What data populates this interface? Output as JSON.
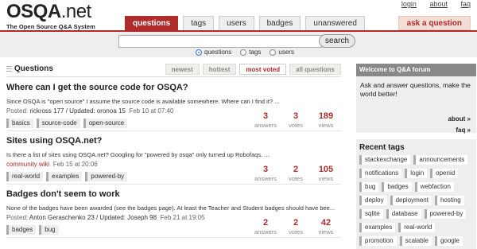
{
  "toplinks": [
    "login",
    "about",
    "faq"
  ],
  "logo": {
    "main": "OSQA",
    "net": ".net",
    "sub": "The Open Source Q&A System"
  },
  "nav": {
    "tabs": [
      "questions",
      "tags",
      "users",
      "badges",
      "unanswered"
    ],
    "active": "questions",
    "ask": "ask a question"
  },
  "search": {
    "value": "",
    "placeholder": "",
    "button": "search",
    "scopes": [
      "questions",
      "tags",
      "users"
    ],
    "selected_scope": "questions"
  },
  "questions_header": {
    "title": "Questions",
    "sorts": [
      "newest",
      "hottest",
      "most voted",
      "all questions"
    ],
    "active_sort": "most voted"
  },
  "questions": [
    {
      "title": "Where can I get the source code for OSQA?",
      "excerpt": "Since OSQA is \"open source\" I assume the source code is available somewhere. Where can I find it? ...",
      "meta_prefix": "Posted:",
      "meta_who": "rickross 177 / Updated: oronoa 15",
      "meta_when": "Feb 10 at 07:40",
      "tags": [
        "basics",
        "source-code",
        "open-source"
      ],
      "answers": "3",
      "votes": "3",
      "views": "189"
    },
    {
      "title": "Sites using OSQA.net?",
      "excerpt": "Is there a list of sites using OSQA.net? Googling for \"powered by osqa\" only turned up Robofaqs. ...",
      "meta_prefix": "",
      "meta_who": "community wiki",
      "meta_when": "Feb 15 at 20:06",
      "tags": [
        "real-world",
        "examples",
        "powered-by"
      ],
      "answers": "3",
      "votes": "2",
      "views": "105"
    },
    {
      "title": "Badges don't seem to work",
      "excerpt": "None of the badges have been awarded (see the badges page). At least the Teacher and Student badges should have bee...",
      "meta_prefix": "Posted:",
      "meta_who": "Anton Geraschenko 23 / Updated: Joseph 98",
      "meta_when": "Feb 21 at 19:05",
      "tags": [
        "badges",
        "bug"
      ],
      "answers": "2",
      "votes": "2",
      "views": "42"
    }
  ],
  "stat_labels": {
    "answers": "answers",
    "votes": "votes",
    "views": "views"
  },
  "sidebar": {
    "welcome_title": "Welcome to Q&A forum",
    "welcome_text": "Ask and answer questions, make the world better!",
    "about_link": "about »",
    "faq_link": "faq »",
    "recent_title": "Recent tags",
    "recent_tags": [
      "stackexchange",
      "announcements",
      "notifications",
      "login",
      "openid",
      "bug",
      "badges",
      "webfaction",
      "deploy",
      "deployment",
      "hosting",
      "sqlite",
      "database",
      "powered-by",
      "examples",
      "real-world",
      "promotion",
      "scalable",
      "google"
    ]
  },
  "colors": {
    "accent": "#b02b2c",
    "band": "#eeeeee",
    "sidebar_head": "#888888"
  }
}
